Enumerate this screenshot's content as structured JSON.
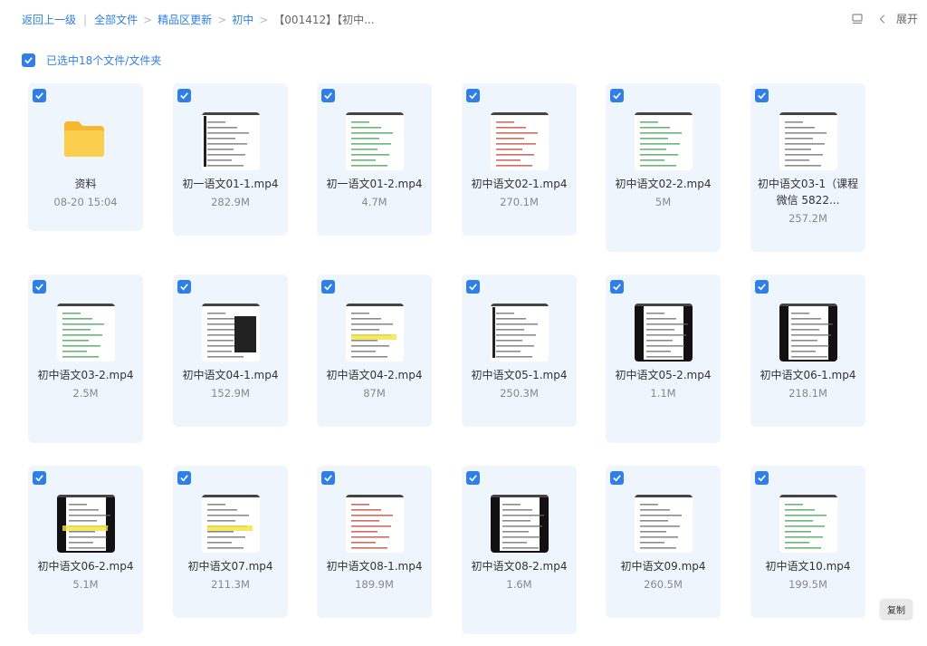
{
  "breadcrumb": {
    "back": "返回上一级",
    "items": [
      "全部文件",
      "精品区更新",
      "初中",
      "【001412】【初中..."
    ]
  },
  "toolbar": {
    "expand_label": "展开",
    "view_icon": "list-view-icon",
    "collapse_icon": "chevron-left-icon"
  },
  "selection": {
    "label": "已选中18个文件/文件夹"
  },
  "colors": {
    "accent": "#2f7fe6",
    "card_bg": "#eef5fd",
    "folder": "#f7c343"
  },
  "files": [
    {
      "name": "资料",
      "meta": "08-20 15:04",
      "type": "folder"
    },
    {
      "name": "初一语文01-1.mp4",
      "meta": "282.9M",
      "type": "video"
    },
    {
      "name": "初一语文01-2.mp4",
      "meta": "4.7M",
      "type": "video"
    },
    {
      "name": "初中语文02-1.mp4",
      "meta": "270.1M",
      "type": "video"
    },
    {
      "name": "初中语文02-2.mp4",
      "meta": "5M",
      "type": "video"
    },
    {
      "name": "初中语文03-1（课程微信 5822...",
      "meta": "257.2M",
      "type": "video"
    },
    {
      "name": "初中语文03-2.mp4",
      "meta": "2.5M",
      "type": "video"
    },
    {
      "name": "初中语文04-1.mp4",
      "meta": "152.9M",
      "type": "video"
    },
    {
      "name": "初中语文04-2.mp4",
      "meta": "87M",
      "type": "video"
    },
    {
      "name": "初中语文05-1.mp4",
      "meta": "250.3M",
      "type": "video"
    },
    {
      "name": "初中语文05-2.mp4",
      "meta": "1.1M",
      "type": "video"
    },
    {
      "name": "初中语文06-1.mp4",
      "meta": "218.1M",
      "type": "video"
    },
    {
      "name": "初中语文06-2.mp4",
      "meta": "5.1M",
      "type": "video"
    },
    {
      "name": "初中语文07.mp4",
      "meta": "211.3M",
      "type": "video"
    },
    {
      "name": "初中语文08-1.mp4",
      "meta": "189.9M",
      "type": "video"
    },
    {
      "name": "初中语文08-2.mp4",
      "meta": "1.6M",
      "type": "video"
    },
    {
      "name": "初中语文09.mp4",
      "meta": "260.5M",
      "type": "video"
    },
    {
      "name": "初中语文10.mp4",
      "meta": "199.5M",
      "type": "video"
    }
  ],
  "copy_button": "复制"
}
